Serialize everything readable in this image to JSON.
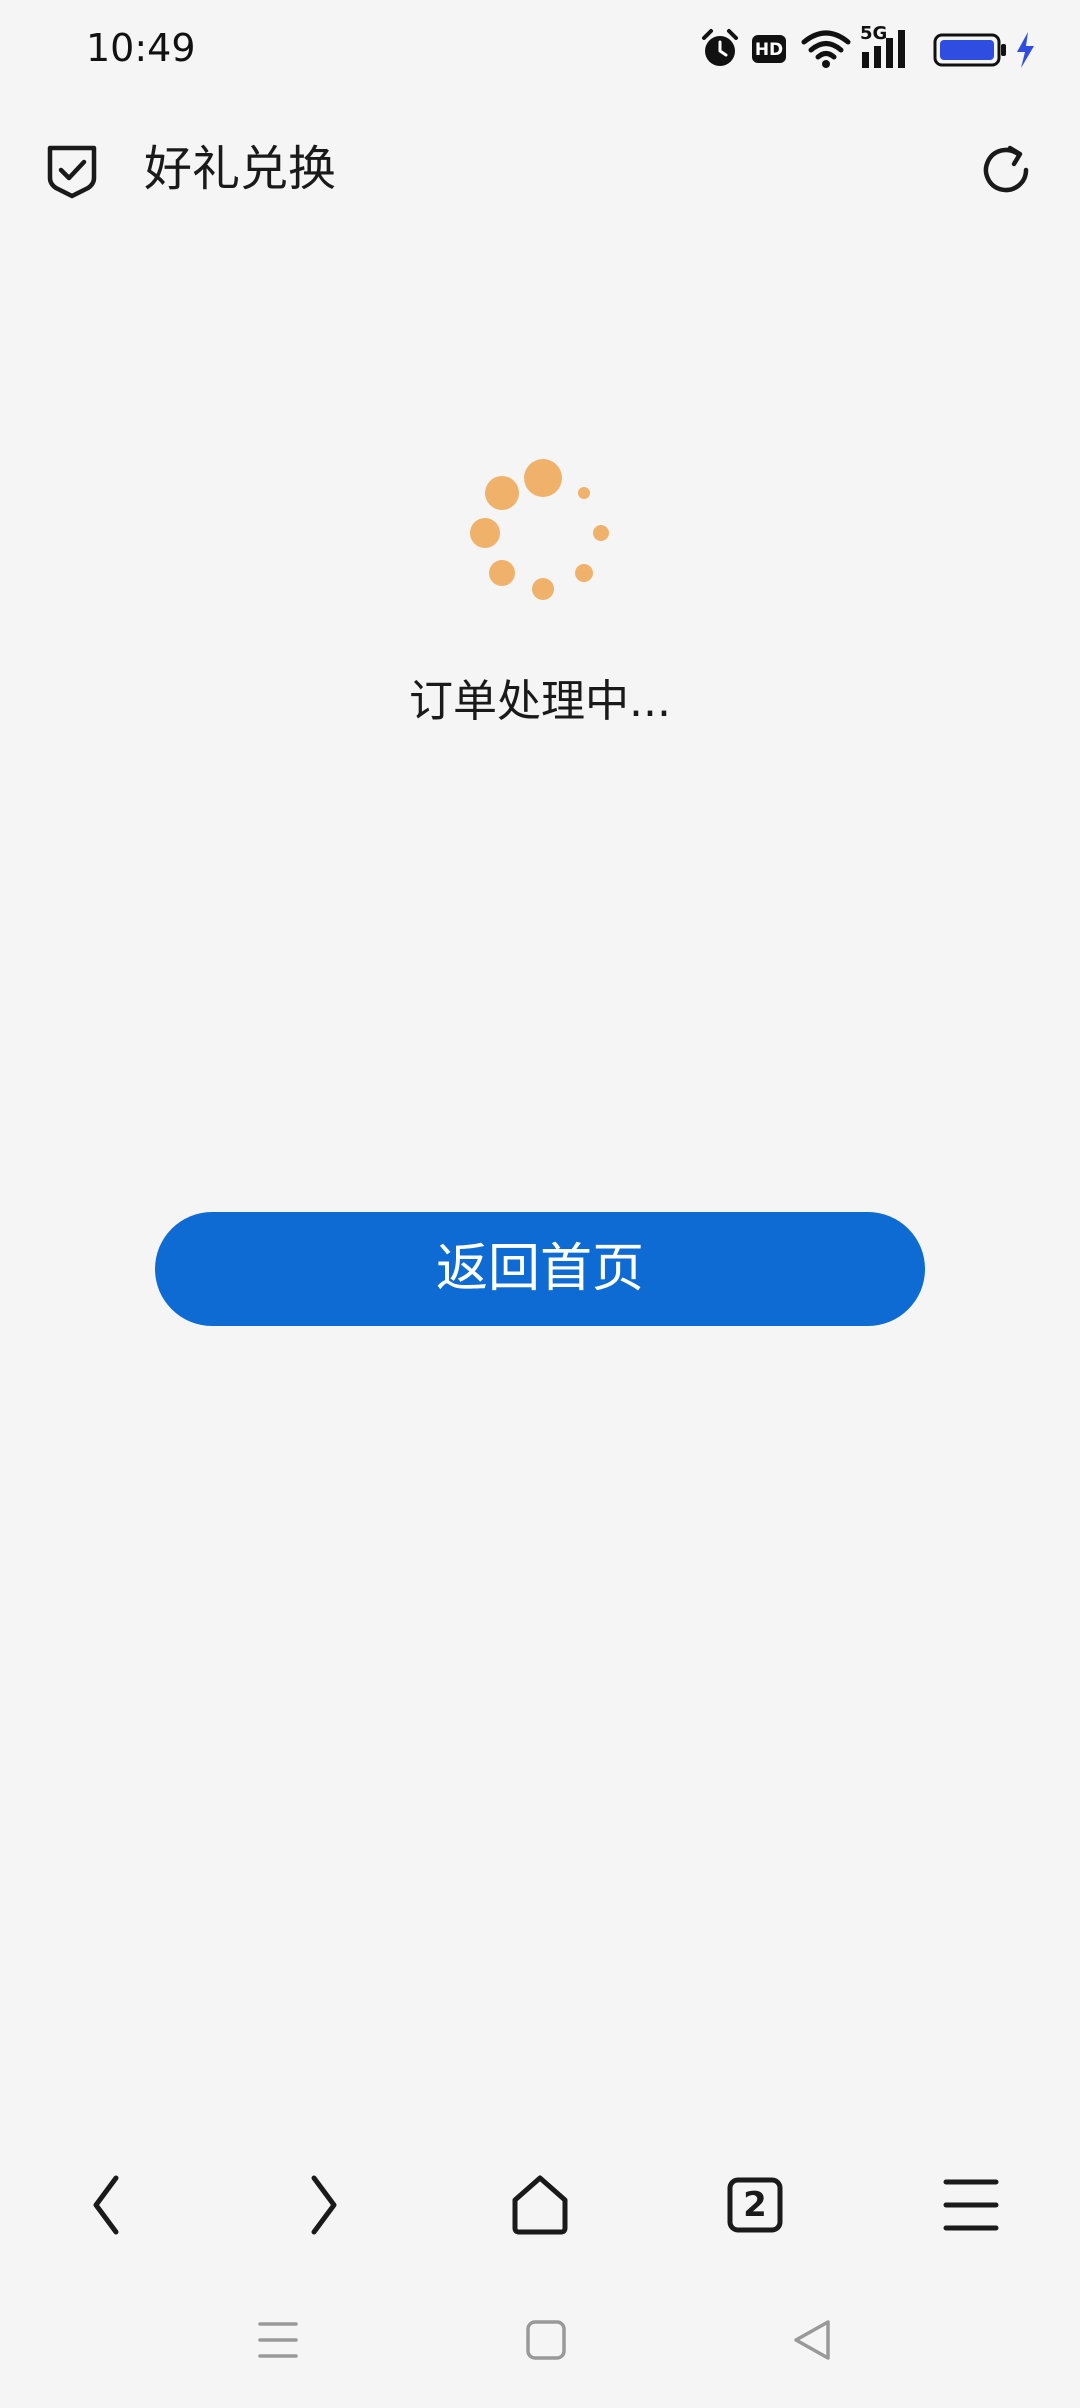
{
  "status_bar": {
    "time": "10:49",
    "hd_badge": "HD",
    "network_label": "5G",
    "battery_color": "#2f4de0",
    "charging_color": "#2f4de0"
  },
  "header": {
    "title": "好礼兑换",
    "left_icon": "shield-check-icon",
    "right_icon": "refresh-icon"
  },
  "main": {
    "spinner_color": "#f0b26b",
    "status_text": "订单处理中...",
    "home_button_label": "返回首页",
    "home_button_color": "#0e6bd4"
  },
  "browser_toolbar": {
    "tab_count": "2",
    "items": [
      "back-icon",
      "forward-icon",
      "home-icon",
      "tabs-icon",
      "menu-icon"
    ]
  },
  "system_nav": {
    "items": [
      "recent-apps-icon",
      "home-square-icon",
      "back-triangle-icon"
    ]
  }
}
